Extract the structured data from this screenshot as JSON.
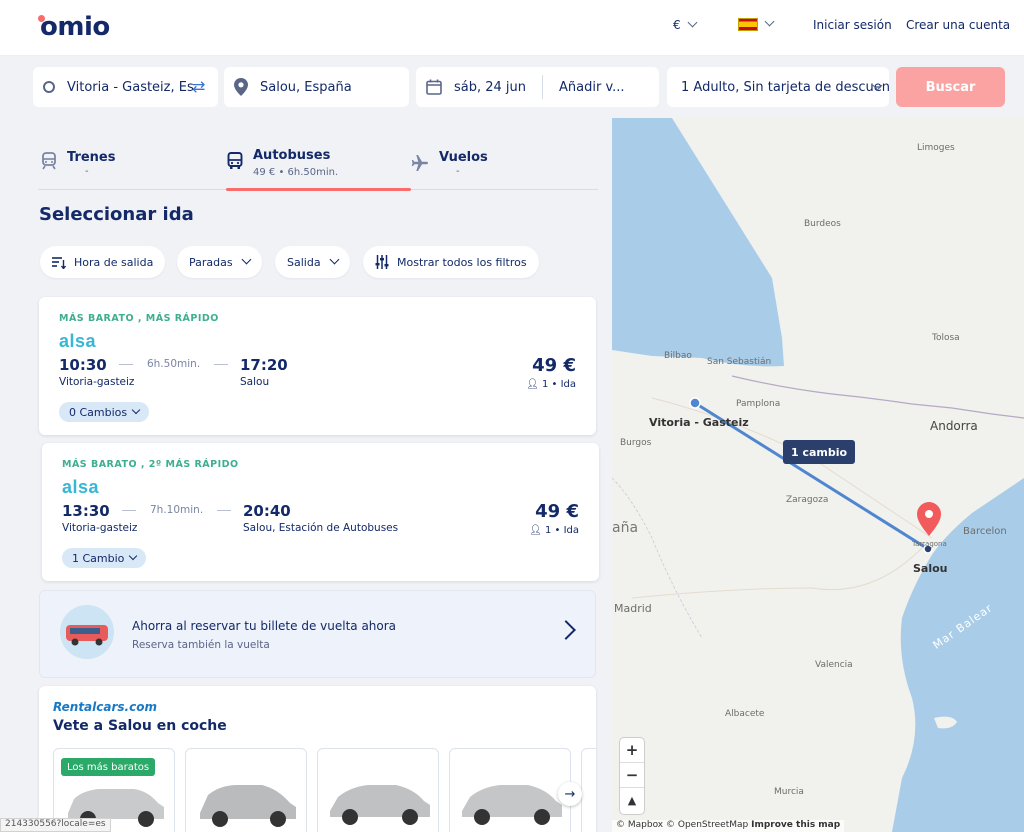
{
  "header": {
    "logo": "omio",
    "currency": "€",
    "language_flag": "spain-flag",
    "login": "Iniciar sesión",
    "create_account": "Crear una cuenta"
  },
  "search": {
    "origin": "Vitoria - Gasteiz, Es",
    "destination": "Salou, España",
    "date": "sáb, 24 jun",
    "return_placeholder": "Añadir v...",
    "passengers": "1 Adulto, Sin tarjeta de descuen",
    "search_button": "Buscar"
  },
  "tabs": [
    {
      "label": "Trenes",
      "sub": "-",
      "icon": "train-icon"
    },
    {
      "label": "Autobuses",
      "sub": "49 € • 6h.50min.",
      "icon": "bus-icon",
      "active": true
    },
    {
      "label": "Vuelos",
      "sub": "-",
      "icon": "plane-icon"
    }
  ],
  "page_title": "Seleccionar ida",
  "filters": {
    "departure_time": "Hora de salida",
    "stops": "Paradas",
    "departure": "Salida",
    "all_filters": "Mostrar todos los filtros"
  },
  "results": [
    {
      "tags": "MÁS BARATO ,  MÁS RÁPIDO",
      "operator": "alsa",
      "dep_time": "10:30",
      "duration": "6h.50min.",
      "arr_time": "17:20",
      "from": "Vitoria-gasteiz",
      "to": "Salou",
      "price": "49 €",
      "pax": "1 • Ida",
      "changes": "0 Cambios"
    },
    {
      "tags": "MÁS BARATO ,  2º MÁS RÁPIDO",
      "operator": "alsa",
      "dep_time": "13:30",
      "duration": "7h.10min.",
      "arr_time": "20:40",
      "from": "Vitoria-gasteiz",
      "to": "Salou, Estación de Autobuses",
      "price": "49 €",
      "pax": "1 • Ida",
      "changes": "1 Cambio"
    }
  ],
  "return_promo": {
    "title": "Ahorra al reservar tu billete de vuelta ahora",
    "subtitle": "Reserva también la vuelta"
  },
  "rental": {
    "logo": "Rentalcars.com",
    "title": "Vete a Salou en coche",
    "badge": "Los más baratos"
  },
  "status_url": "214330556?locale=es",
  "map": {
    "labels": {
      "limoges": "Limoges",
      "burdeos": "Burdeos",
      "tolosa": "Tolosa",
      "bilbao": "Bilbao",
      "san_sebastian": "San Sebastián",
      "pamplona": "Pamplona",
      "burgos": "Burgos",
      "andorra": "Andorra",
      "zaragoza": "Zaragoza",
      "barcelona": "Barcelon",
      "tarragona": "Tarragona",
      "madrid": "Madrid",
      "valencia": "Valencia",
      "albacete": "Albacete",
      "murcia": "Murcia",
      "espana": "aña",
      "mar_balear": "Mar Balear",
      "origin": "Vitoria - Gasteiz",
      "destination": "Salou"
    },
    "route_badge": "1 cambio",
    "zoom_in": "+",
    "zoom_out": "−",
    "compass": "▲",
    "attribution_mapbox": "© Mapbox",
    "attribution_osm": "© OpenStreetMap",
    "attribution_improve": "Improve this map",
    "colors": {
      "route": "#4f86cf",
      "sea": "#a9cde9",
      "marker": "#f25b5b"
    }
  }
}
